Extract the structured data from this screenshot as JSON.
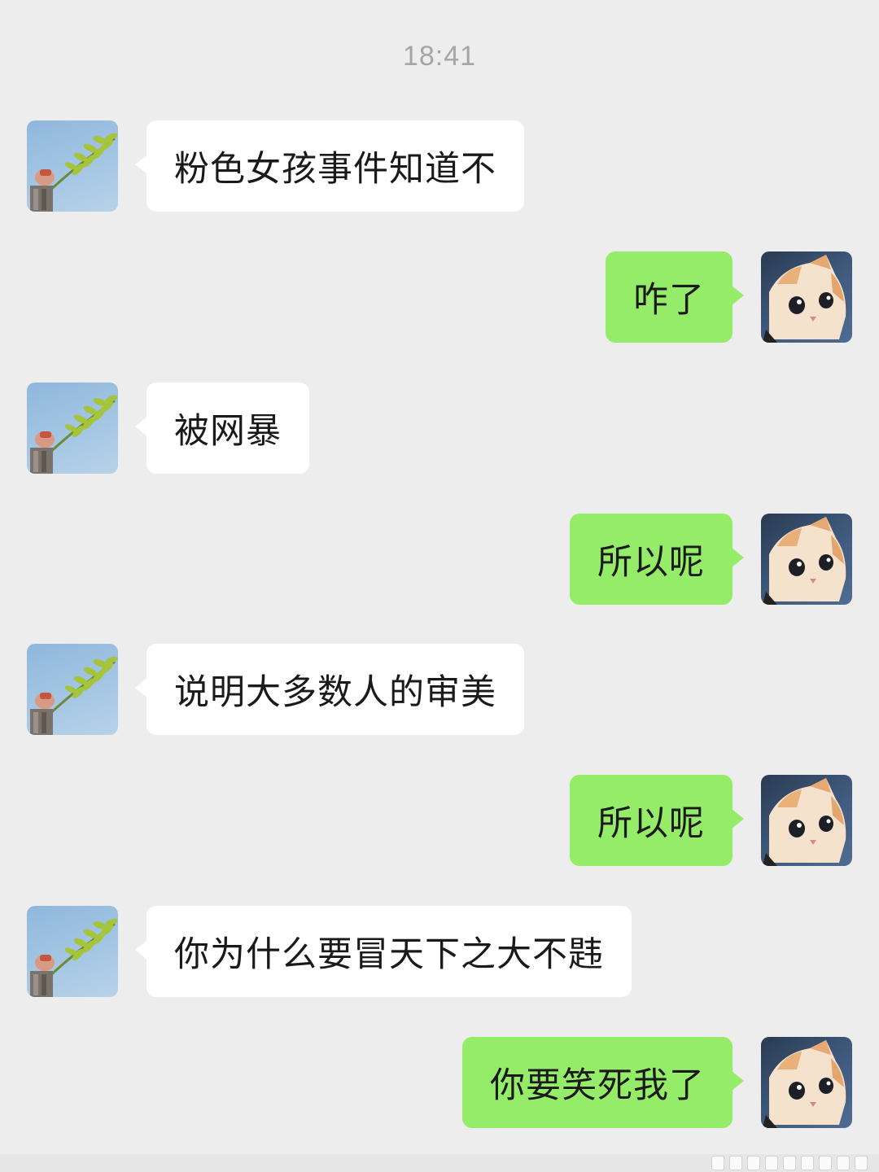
{
  "chat": {
    "timestamp": "18:41",
    "messages": [
      {
        "side": "left",
        "text": "粉色女孩事件知道不"
      },
      {
        "side": "right",
        "text": "咋了"
      },
      {
        "side": "left",
        "text": "被网暴"
      },
      {
        "side": "right",
        "text": "所以呢"
      },
      {
        "side": "left",
        "text": "说明大多数人的审美"
      },
      {
        "side": "right",
        "text": "所以呢"
      },
      {
        "side": "left",
        "text": "你为什么要冒天下之大不韪"
      },
      {
        "side": "right",
        "text": "你要笑死我了"
      }
    ]
  },
  "colors": {
    "background": "#ededed",
    "incoming_bubble": "#ffffff",
    "outgoing_bubble": "#95ec69",
    "timestamp_text": "#a5a5a5"
  },
  "icons": {
    "contact_avatar": "leaf-branch-avatar-icon",
    "self_avatar": "kitten-avatar-icon"
  }
}
